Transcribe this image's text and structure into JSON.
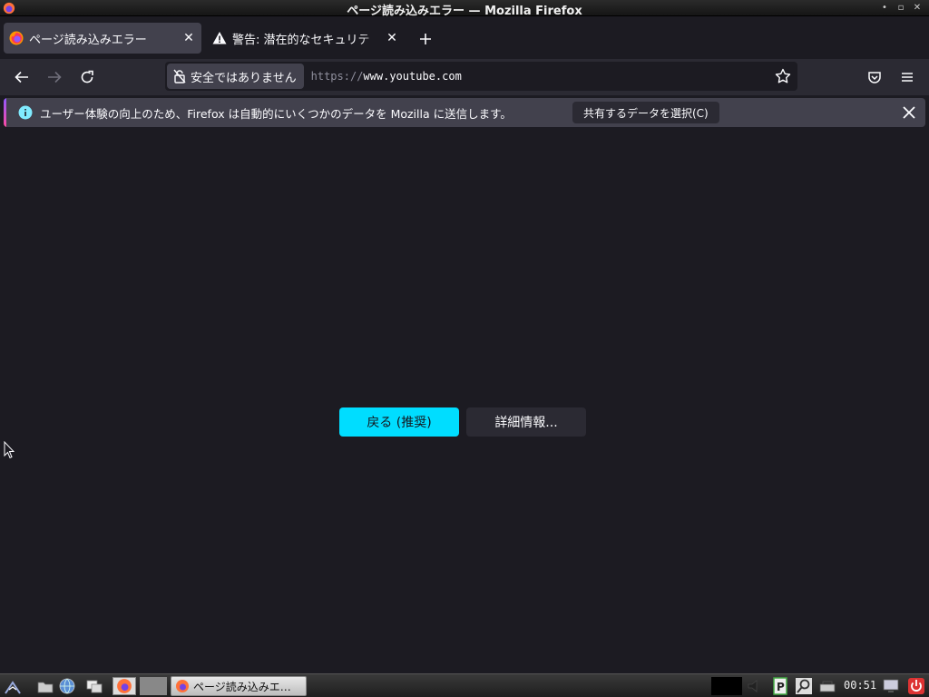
{
  "window": {
    "title": "ページ読み込みエラー — Mozilla Firefox"
  },
  "tabs": [
    {
      "label": "ページ読み込みエラー",
      "active": true,
      "icon": "firefox-icon"
    },
    {
      "label": "警告: 潜在的なセキュリテ",
      "active": false,
      "icon": "warning-icon"
    }
  ],
  "navbar": {
    "identity_label": "安全ではありません",
    "url_scheme": "https://",
    "url_host": "www.youtube.com"
  },
  "notification": {
    "message": "ユーザー体験の向上のため、Firefox は自動的にいくつかのデータを Mozilla に送信します。",
    "button_label": "共有するデータを選択(C)"
  },
  "content": {
    "back_button": "戻る (推奨)",
    "advanced_button": "詳細情報..."
  },
  "taskbar": {
    "task_label": "ページ読み込みエ…",
    "clock": "00:51"
  },
  "colors": {
    "accent": "#00ddff",
    "background": "#1c1b22",
    "toolbar": "#2b2a33",
    "notification": "#42414d"
  }
}
